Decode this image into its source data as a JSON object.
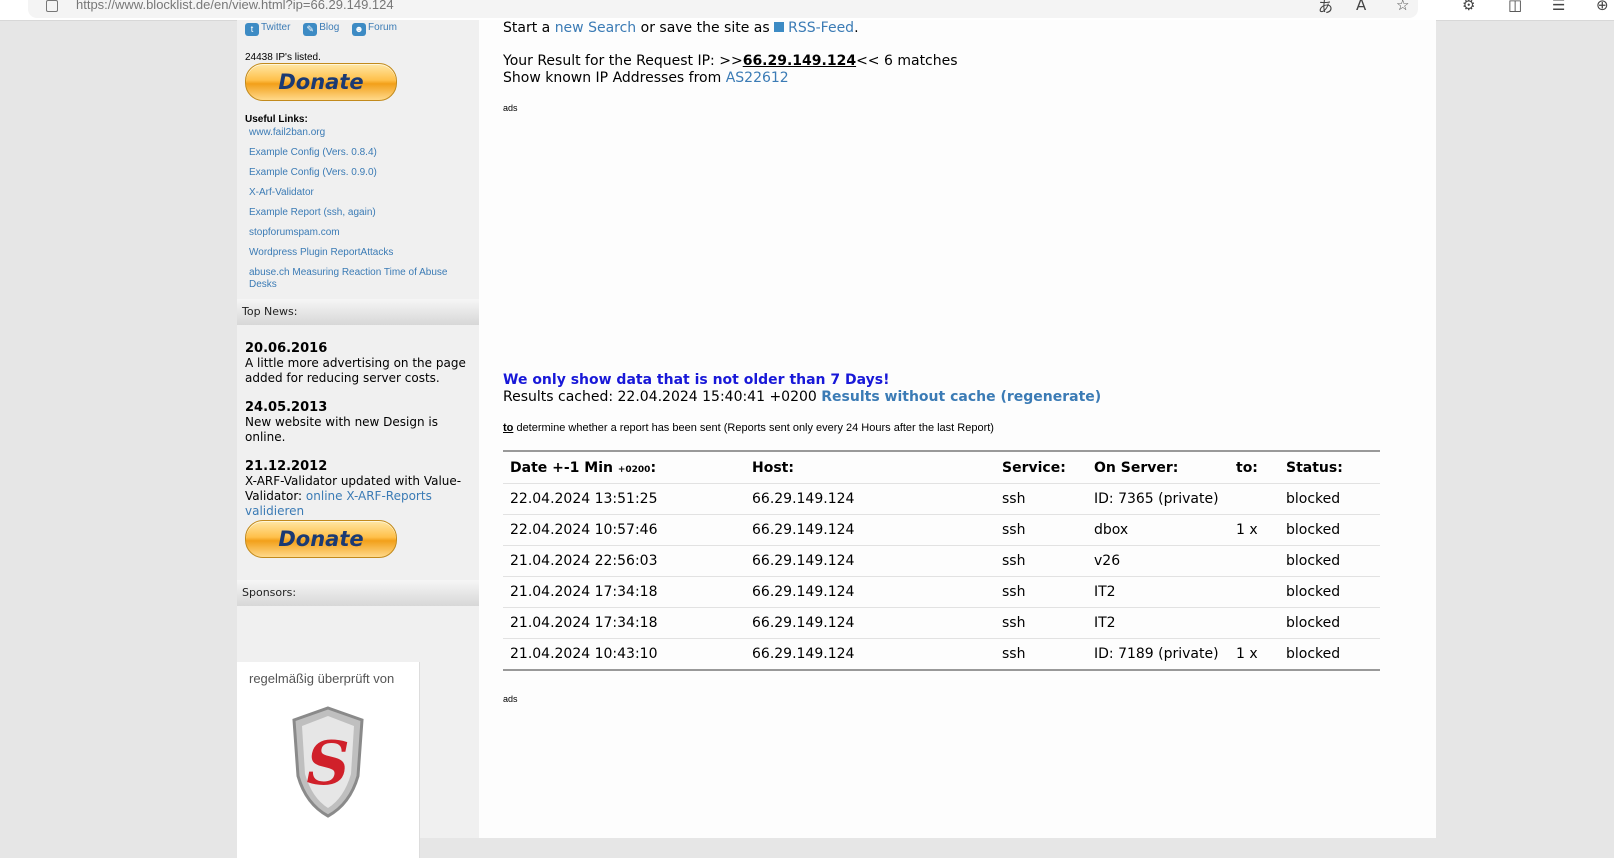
{
  "browser": {
    "url_prefix": "https://www.blocklist.de",
    "url_path": "/en/view.html?ip=66.29.149.124"
  },
  "sidebar": {
    "social": [
      "Twitter",
      "Blog",
      "Forum"
    ],
    "listed": "24438 IP's listed.",
    "donate_label": "Donate",
    "useful_title": "Useful Links:",
    "useful_links": [
      "www.fail2ban.org",
      "Example Config (Vers. 0.8.4)",
      "Example Config (Vers. 0.9.0)",
      "X-Arf-Validator",
      "Example Report (ssh, again)",
      "stopforumspam.com",
      "Wordpress Plugin ReportAttacks",
      "abuse.ch Measuring Reaction Time of Abuse Desks"
    ],
    "top_news_title": "Top News:",
    "news": [
      {
        "date": "20.06.2016",
        "text": "A little more advertising on the page added for reducing server costs."
      },
      {
        "date": "24.05.2013",
        "text": "New website with new Design is online."
      },
      {
        "date": "21.12.2012",
        "text": "X-ARF-Validator updated with Value-Validator: ",
        "link": "online X-ARF-Reports validieren"
      }
    ],
    "sponsors_title": "Sponsors:",
    "sponsor_badge_text": "regelmäßig überprüft von"
  },
  "main": {
    "search_line": {
      "pre": "Start a ",
      "new_search": "new Search",
      "mid": " or save the site as ",
      "rss": "RSS-Feed",
      "post": "."
    },
    "result_line": {
      "pre": "Your Result for the Request IP: >>",
      "ip": "66.29.149.124",
      "post": "<< 6 matches"
    },
    "known_line": {
      "pre": "Show known IP Addresses from ",
      "as": "AS22612"
    },
    "ads_label": "ads",
    "warning": "We only show data that is not older than 7 Days!",
    "cached_pre": "Results cached: 22.04.2024 15:40:41 +0200 ",
    "cached_link": "Results without cache (regenerate)",
    "note_to": "to",
    "note_rest": " determine whether a report has been sent (Reports sent only every 24 Hours after the last Report)",
    "table": {
      "headers": {
        "date": "Date +-1 Min ",
        "date_small": "+0200",
        "date_colon": ":",
        "host": "Host:",
        "service": "Service:",
        "server": "On Server:",
        "to": "to:",
        "status": "Status:"
      },
      "rows": [
        {
          "date": "22.04.2024 13:51:25",
          "host": "66.29.149.124",
          "service": "ssh",
          "server": "ID: 7365 (private)",
          "to": "",
          "status": "blocked"
        },
        {
          "date": "22.04.2024 10:57:46",
          "host": "66.29.149.124",
          "service": "ssh",
          "server": "dbox",
          "to": "1 x",
          "status": "blocked"
        },
        {
          "date": "21.04.2024 22:56:03",
          "host": "66.29.149.124",
          "service": "ssh",
          "server": "v26",
          "to": "",
          "status": "blocked"
        },
        {
          "date": "21.04.2024 17:34:18",
          "host": "66.29.149.124",
          "service": "ssh",
          "server": "IT2",
          "to": "",
          "status": "blocked"
        },
        {
          "date": "21.04.2024 17:34:18",
          "host": "66.29.149.124",
          "service": "ssh",
          "server": "IT2",
          "to": "",
          "status": "blocked"
        },
        {
          "date": "21.04.2024 10:43:10",
          "host": "66.29.149.124",
          "service": "ssh",
          "server": "ID: 7189 (private)",
          "to": "1 x",
          "status": "blocked"
        }
      ]
    }
  }
}
